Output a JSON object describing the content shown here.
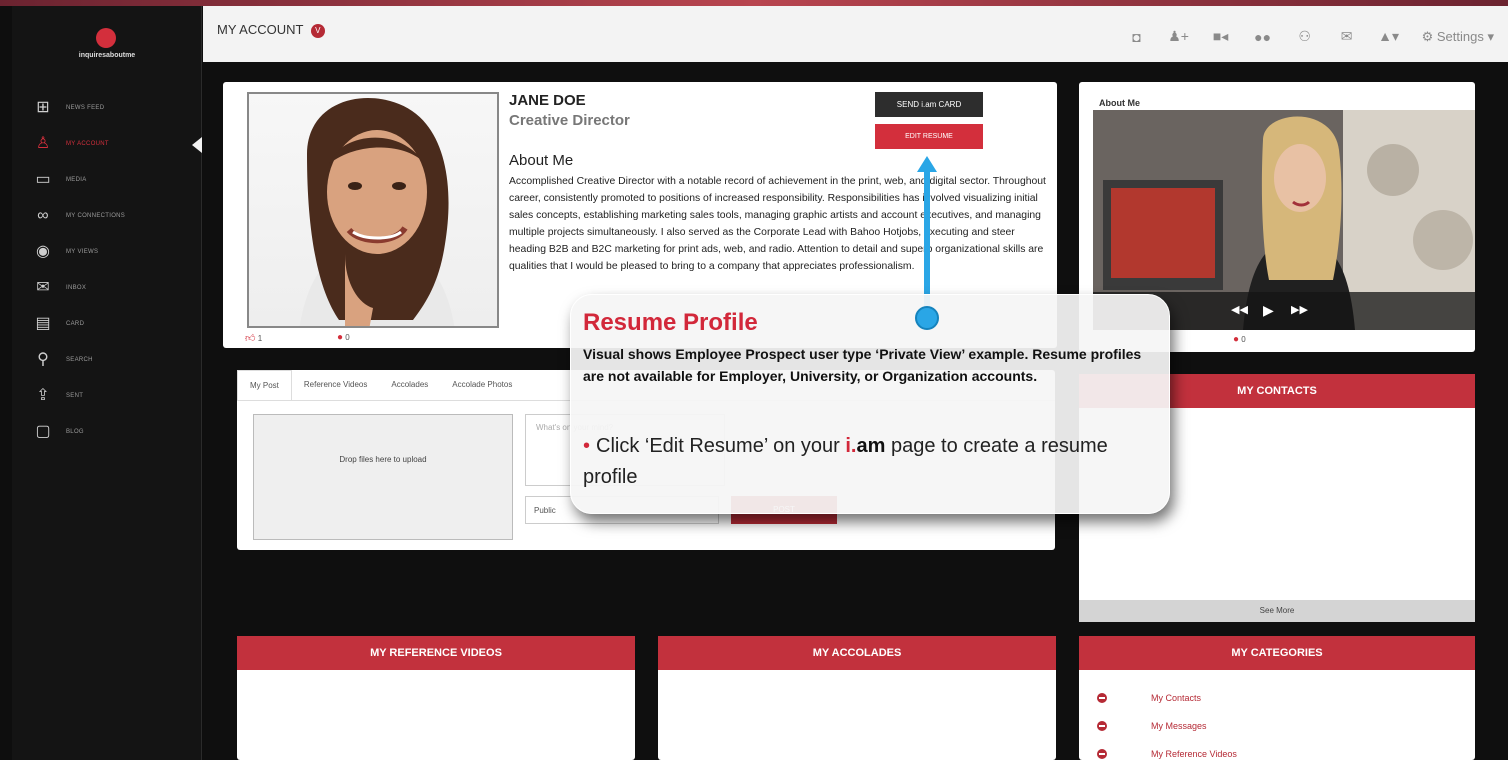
{
  "brand": {
    "name": "inquiresaboutme"
  },
  "sidebar": {
    "items": [
      {
        "label": "NEWS FEED",
        "icon": "news-feed-icon",
        "glyph": "⊞"
      },
      {
        "label": "MY ACCOUNT",
        "icon": "user-icon",
        "glyph": "♙",
        "active": true
      },
      {
        "label": "MEDIA",
        "icon": "monitor-icon",
        "glyph": "▭"
      },
      {
        "label": "MY CONNECTIONS",
        "icon": "link-icon",
        "glyph": "∞"
      },
      {
        "label": "MY VIEWS",
        "icon": "eye-icon",
        "glyph": "◉"
      },
      {
        "label": "INBOX",
        "icon": "mail-icon",
        "glyph": "✉"
      },
      {
        "label": "CARD",
        "icon": "card-icon",
        "glyph": "▤"
      },
      {
        "label": "SEARCH",
        "icon": "search-icon",
        "glyph": "⚲"
      },
      {
        "label": "SENT",
        "icon": "share-icon",
        "glyph": "⇪"
      },
      {
        "label": "BLOG",
        "icon": "blog-icon",
        "glyph": "▢"
      }
    ]
  },
  "header": {
    "title": "MY ACCOUNT",
    "badge": "V",
    "icons": [
      "camera-icon",
      "add-user-icon",
      "video-icon",
      "chat-icon",
      "group-icon",
      "envelope-icon",
      "bell-icon"
    ],
    "settings_label": "Settings"
  },
  "profile": {
    "name": "JANE DOE",
    "role": "Creative Director",
    "about_heading": "About Me",
    "about_text": "Accomplished Creative Director with a notable record of achievement in the print, web, and digital sector. Throughout career, consistently promoted to positions of increased responsibility. Responsibilities has involved visualizing initial sales concepts, establishing marketing sales tools, managing graphic artists and account executives, and managing multiple projects simultaneously. I also served as the Corporate Lead with Bahoo Hotjobs, executing and steer heading B2B and B2C marketing for print ads, web, and radio. Attention to detail and superb organizational skills are qualities that I would be pleased to bring to a company that appreciates professionalism.",
    "send_card_label": "SEND i.am CARD",
    "edit_resume_label": "EDIT RESUME",
    "likes": "1",
    "comments": "0"
  },
  "video": {
    "title": "About Me",
    "comments": "0"
  },
  "post": {
    "tabs": [
      "My Post",
      "Reference Videos",
      "Accolades",
      "Accolade Photos"
    ],
    "dropzone_label": "Drop files here to upload",
    "text_placeholder": "What's on your mind?",
    "visibility": "Public",
    "post_button": "POST"
  },
  "contacts": {
    "title": "MY CONTACTS",
    "see_more": "See More"
  },
  "reference_videos": {
    "title": "MY REFERENCE VIDEOS"
  },
  "accolades": {
    "title": "MY ACCOLADES"
  },
  "categories": {
    "title": "MY CATEGORIES",
    "items": [
      "My Contacts",
      "My Messages",
      "My Reference Videos"
    ]
  },
  "callout": {
    "heading": "Resume Profile",
    "subtext": "Visual shows Employee Prospect user type ‘Private View’ example. Resume profiles are not available for Employer, University, or Organization accounts.",
    "bullet_prefix": "Click ‘Edit Resume’ on your ",
    "brand_i": "i.",
    "brand_am": "am",
    "bullet_suffix": " page to create a resume profile"
  },
  "colors": {
    "accent": "#c2313d",
    "callout_red": "#d2283a",
    "arrow": "#2aa6e6"
  }
}
